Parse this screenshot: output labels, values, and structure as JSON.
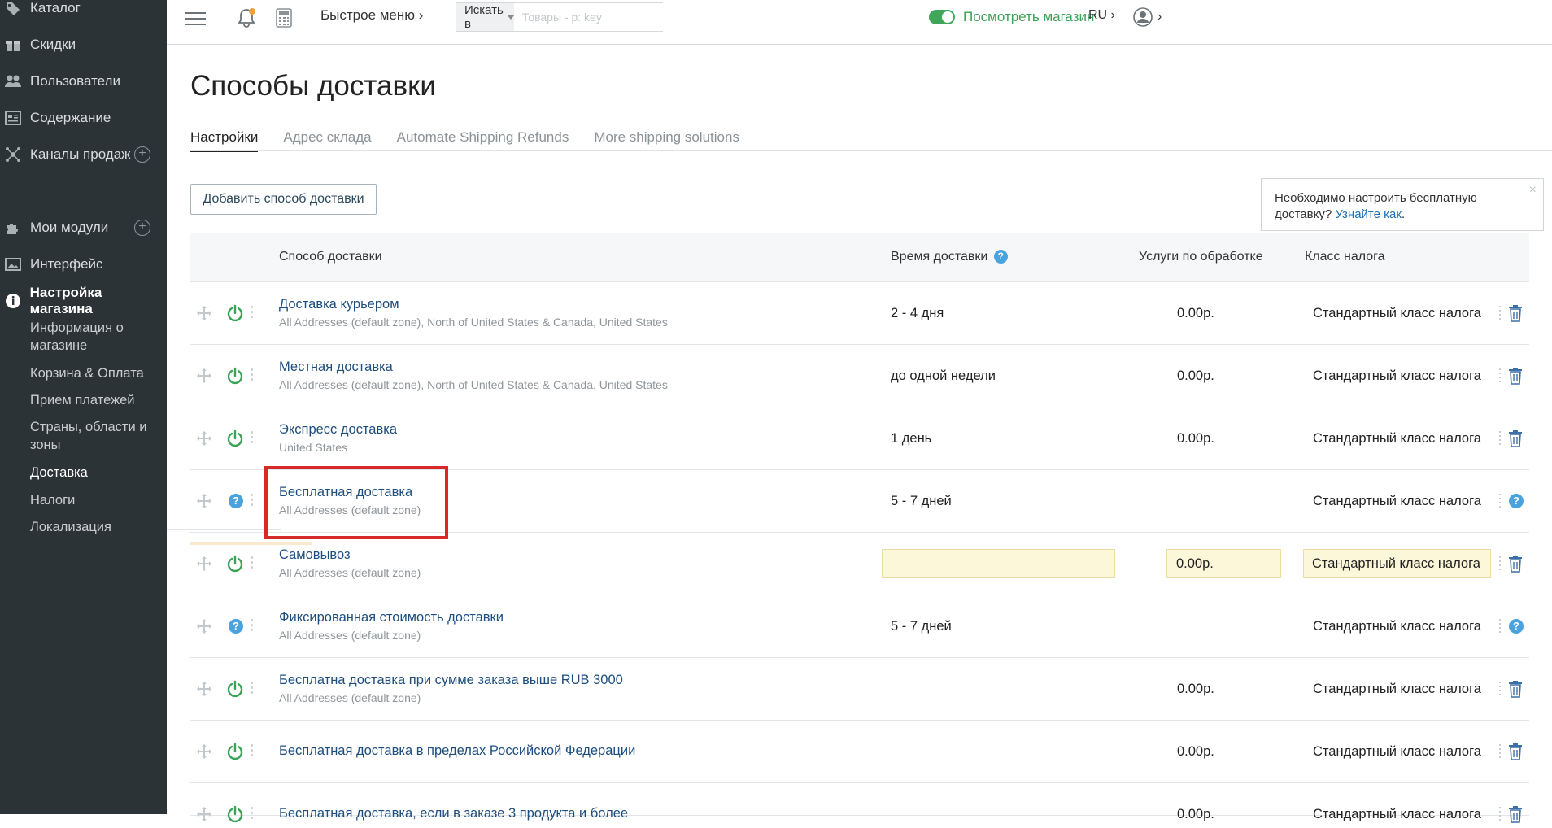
{
  "sidebar": {
    "items": [
      {
        "label": "Каталог",
        "icon": "tag-icon"
      },
      {
        "label": "Скидки",
        "icon": "gift-icon"
      },
      {
        "label": "Пользователи",
        "icon": "users-icon"
      },
      {
        "label": "Содержание",
        "icon": "content-icon"
      },
      {
        "label": "Каналы продаж",
        "icon": "channels-icon"
      },
      {
        "label": "Мои модули",
        "icon": "puzzle-icon"
      },
      {
        "label": "Интерфейс",
        "icon": "image-icon"
      },
      {
        "label": "Настройка магазина",
        "icon": "info-icon"
      }
    ],
    "sub_items": [
      "Информация о магазине",
      "Корзина & Оплата",
      "Прием платежей",
      "Страны, области и зоны",
      "Доставка",
      "Налоги",
      "Локализация"
    ],
    "plus": "+"
  },
  "topbar": {
    "quick_menu": "Быстрое меню ›",
    "search_scope": "Искать в",
    "search_placeholder": "Товары - p: key",
    "view_store": "Посмотреть магазин",
    "lang": "RU ›",
    "user_chevron": "›"
  },
  "page": {
    "title": "Способы доставки",
    "tabs": [
      "Настройки",
      "Адрес склада",
      "Automate Shipping Refunds",
      "More shipping solutions"
    ],
    "add_button": "Добавить способ доставки"
  },
  "notice": {
    "text": "Необходимо настроить бесплатную доставку?",
    "link": "Узнайте как",
    "after": ".",
    "close": "×"
  },
  "table": {
    "headers": {
      "method": "Способ доставки",
      "time": "Время доставки",
      "fee": "Услуги по обработке",
      "tax": "Класс налога"
    },
    "rows": [
      {
        "name": "Доставка курьером",
        "zone": "All Addresses (default zone), North of United States & Canada, United States",
        "time": "2 - 4 дня",
        "fee": "0.00р.",
        "tax": "Стандартный класс налога"
      },
      {
        "name": "Местная доставка",
        "zone": "All Addresses (default zone), North of United States & Canada, United States",
        "time": "до одной недели",
        "fee": "0.00р.",
        "tax": "Стандартный класс налога"
      },
      {
        "name": "Экспресс доставка",
        "zone": "United States",
        "time": "1 день",
        "fee": "0.00р.",
        "tax": "Стандартный класс налога"
      },
      {
        "name": "Бесплатная доставка",
        "zone": "All Addresses (default zone)",
        "time": "5 - 7 дней",
        "fee": "",
        "tax": "Стандартный класс налога"
      },
      {
        "name": "Самовывоз",
        "zone": "All Addresses (default zone)",
        "time": "",
        "fee": "0.00р.",
        "tax": "Стандартный класс налога"
      },
      {
        "name": "Фиксированная стоимость доставки",
        "zone": "All Addresses (default zone)",
        "time": "5 - 7 дней",
        "fee": "",
        "tax": "Стандартный класс налога"
      },
      {
        "name": "Бесплатна доставка при сумме заказа выше RUB 3000",
        "zone": "All Addresses (default zone)",
        "time": "",
        "fee": "0.00р.",
        "tax": "Стандартный класс налога"
      },
      {
        "name": "Бесплатная доставка в пределах Российской Федерации",
        "zone": "",
        "time": "",
        "fee": "0.00р.",
        "tax": "Стандартный класс налога"
      },
      {
        "name": "Бесплатная доставка, если в заказе 3 продукта и более",
        "zone": "",
        "time": "",
        "fee": "0.00р.",
        "tax": "Стандартный класс налога"
      }
    ]
  },
  "colors": {
    "sidebar_bg": "#2c3337",
    "accent_green": "#3aa358",
    "link_blue": "#1d4e7f",
    "highlight_red": "#d62a2a",
    "edit_yellow": "#fdf7d9"
  }
}
